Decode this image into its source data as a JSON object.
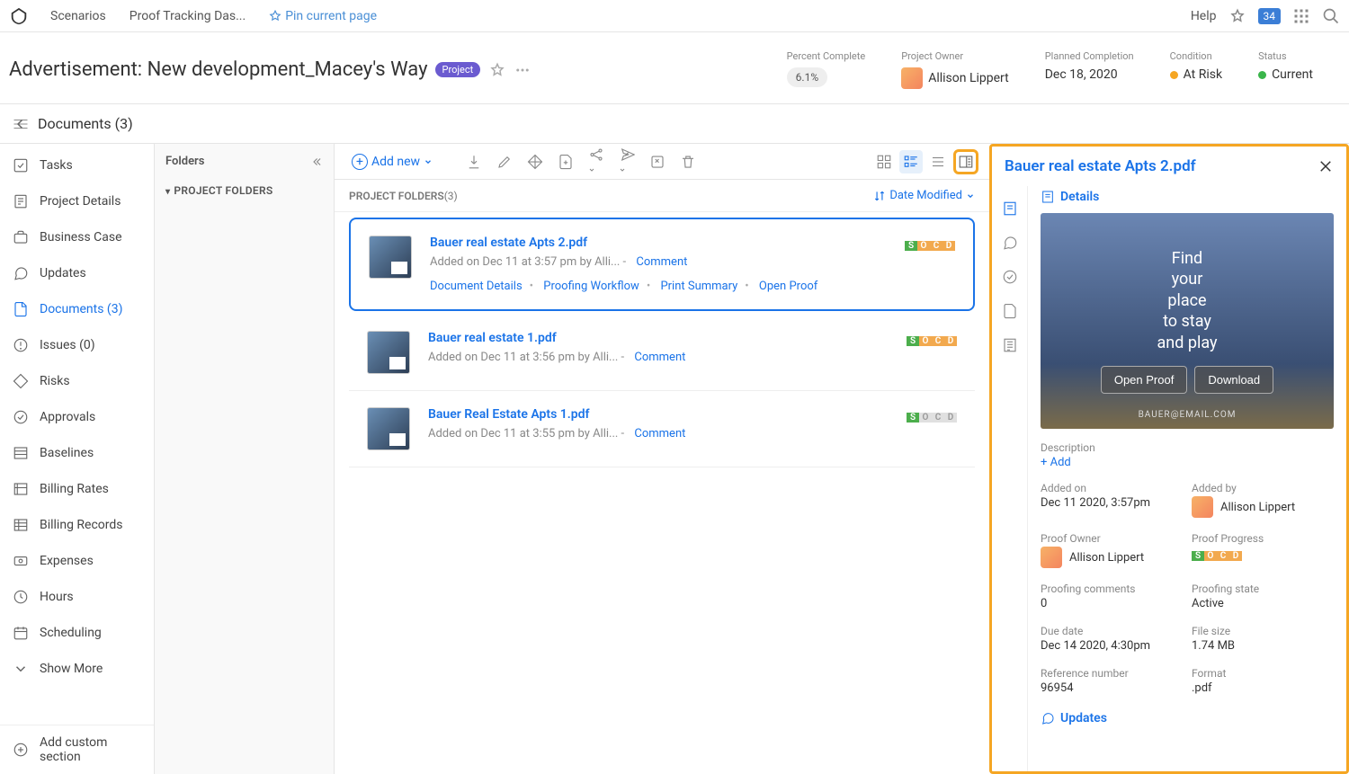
{
  "topbar": {
    "crumbs": [
      "Scenarios",
      "Proof Tracking Das..."
    ],
    "pin": "Pin current page",
    "help": "Help",
    "notif_count": "34"
  },
  "project": {
    "title": "Advertisement: New development_Macey's Way",
    "chip": "Project",
    "stats": {
      "pct_label": "Percent Complete",
      "pct_value": "6.1%",
      "owner_label": "Project Owner",
      "owner_value": "Allison Lippert",
      "planned_label": "Planned Completion",
      "planned_value": "Dec 18, 2020",
      "condition_label": "Condition",
      "condition_value": "At Risk",
      "status_label": "Status",
      "status_value": "Current"
    }
  },
  "section_title": "Documents (3)",
  "nav": {
    "tasks": "Tasks",
    "project_details": "Project Details",
    "business_case": "Business Case",
    "updates": "Updates",
    "documents": "Documents (3)",
    "issues": "Issues (0)",
    "risks": "Risks",
    "approvals": "Approvals",
    "baselines": "Baselines",
    "billing_rates": "Billing Rates",
    "billing_records": "Billing Records",
    "expenses": "Expenses",
    "hours": "Hours",
    "scheduling": "Scheduling",
    "show_more": "Show More",
    "add_custom": "Add custom section"
  },
  "folders": {
    "header": "Folders",
    "group": "PROJECT FOLDERS"
  },
  "toolbar": {
    "add_new": "Add new"
  },
  "list": {
    "group_name": "PROJECT FOLDERS",
    "group_count": "(3)",
    "sort_label": "Date Modified",
    "docs": [
      {
        "name": "Bauer real estate Apts 2.pdf",
        "meta": "Added on Dec 11 at 3:57 pm by Alli...   -",
        "comment": "Comment",
        "links": {
          "dd": "Document Details",
          "pw": "Proofing Workflow",
          "ps": "Print Summary",
          "op": "Open Proof"
        }
      },
      {
        "name": "Bauer real estate 1.pdf",
        "meta": "Added on Dec 11 at 3:56 pm by Alli...   -",
        "comment": "Comment"
      },
      {
        "name": "Bauer Real Estate Apts 1.pdf",
        "meta": "Added on Dec 11 at 3:55 pm by Alli...   -",
        "comment": "Comment"
      }
    ]
  },
  "socd": {
    "s": "S",
    "o": "O",
    "c": "C",
    "d": "D"
  },
  "details": {
    "title": "Bauer real estate Apts 2.pdf",
    "section_details": "Details",
    "preview": {
      "tagline": "Find\nyour\nplace\nto stay\nand play",
      "open_proof": "Open Proof",
      "download": "Download",
      "email": "BAUER@EMAIL.COM"
    },
    "description_label": "Description",
    "add_label": "+ Add",
    "added_on_label": "Added on",
    "added_on_value": "Dec 11 2020, 3:57pm",
    "added_by_label": "Added by",
    "added_by_value": "Allison Lippert",
    "proof_owner_label": "Proof Owner",
    "proof_owner_value": "Allison Lippert",
    "proof_progress_label": "Proof Progress",
    "comments_label": "Proofing comments",
    "comments_value": "0",
    "state_label": "Proofing state",
    "state_value": "Active",
    "due_label": "Due date",
    "due_value": "Dec 14 2020, 4:30pm",
    "size_label": "File size",
    "size_value": "1.74 MB",
    "ref_label": "Reference number",
    "ref_value": "96954",
    "format_label": "Format",
    "format_value": ".pdf",
    "updates_section": "Updates"
  }
}
